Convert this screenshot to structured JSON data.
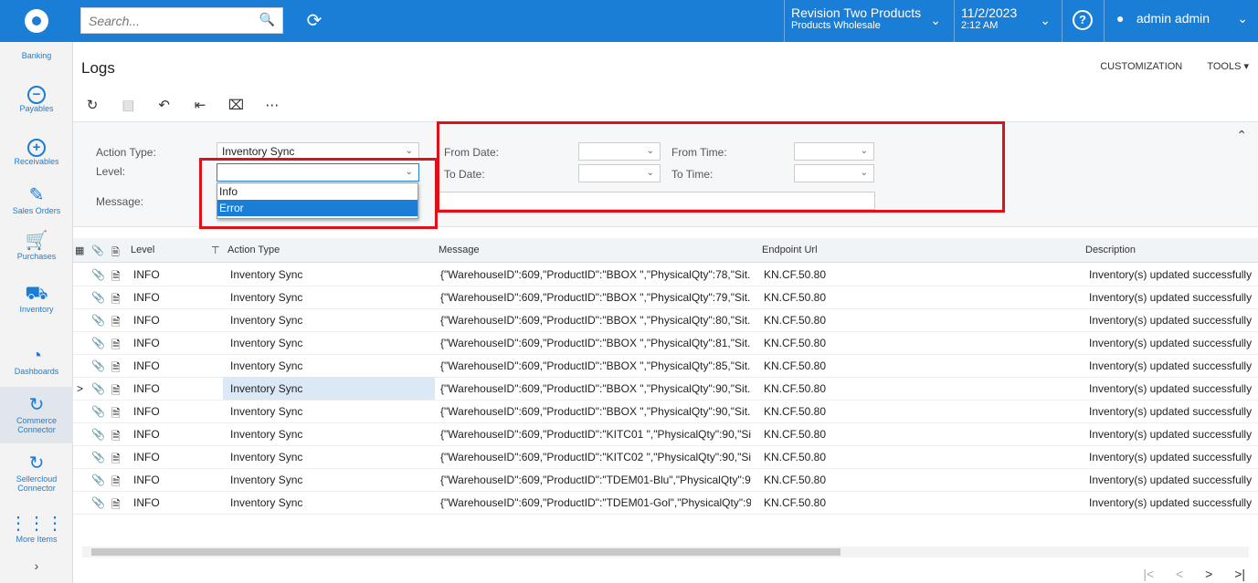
{
  "topbar": {
    "search_placeholder": "Search...",
    "branch_name": "Revision Two Products",
    "branch_sub": "Products Wholesale",
    "date": "11/2/2023",
    "time": "2:12 AM",
    "user": "admin admin"
  },
  "sidebar": {
    "items": [
      {
        "label": "Banking"
      },
      {
        "label": "Payables"
      },
      {
        "label": "Receivables"
      },
      {
        "label": "Sales Orders"
      },
      {
        "label": "Purchases"
      },
      {
        "label": "Inventory"
      },
      {
        "label": "Dashboards"
      },
      {
        "label": "Commerce Connector"
      },
      {
        "label": "Sellercloud Connector"
      },
      {
        "label": "More Items"
      }
    ]
  },
  "page": {
    "title": "Logs",
    "customization": "CUSTOMIZATION",
    "tools": "TOOLS"
  },
  "filter": {
    "action_type_label": "Action Type:",
    "action_type_value": "Inventory Sync",
    "level_label": "Level:",
    "level_value": "",
    "message_label": "Message:",
    "from_date_label": "From Date:",
    "to_date_label": "To Date:",
    "from_time_label": "From Time:",
    "to_time_label": "To Time:",
    "level_options": [
      "Info",
      "Error"
    ]
  },
  "grid": {
    "columns": [
      "Level",
      "Action Type",
      "Message",
      "Endpoint Url",
      "Description"
    ],
    "rows": [
      {
        "level": "INFO",
        "action": "Inventory Sync",
        "message": "{\"WarehouseID\":609,\"ProductID\":\"BBOX \",\"PhysicalQty\":78,\"Sit...",
        "endpoint": "KN.CF.50.80",
        "description": "Inventory(s) updated successfully"
      },
      {
        "level": "INFO",
        "action": "Inventory Sync",
        "message": "{\"WarehouseID\":609,\"ProductID\":\"BBOX \",\"PhysicalQty\":79,\"Sit...",
        "endpoint": "KN.CF.50.80",
        "description": "Inventory(s) updated successfully"
      },
      {
        "level": "INFO",
        "action": "Inventory Sync",
        "message": "{\"WarehouseID\":609,\"ProductID\":\"BBOX \",\"PhysicalQty\":80,\"Sit...",
        "endpoint": "KN.CF.50.80",
        "description": "Inventory(s) updated successfully"
      },
      {
        "level": "INFO",
        "action": "Inventory Sync",
        "message": "{\"WarehouseID\":609,\"ProductID\":\"BBOX \",\"PhysicalQty\":81,\"Sit...",
        "endpoint": "KN.CF.50.80",
        "description": "Inventory(s) updated successfully"
      },
      {
        "level": "INFO",
        "action": "Inventory Sync",
        "message": "{\"WarehouseID\":609,\"ProductID\":\"BBOX \",\"PhysicalQty\":85,\"Sit...",
        "endpoint": "KN.CF.50.80",
        "description": "Inventory(s) updated successfully"
      },
      {
        "level": "INFO",
        "action": "Inventory Sync",
        "message": "{\"WarehouseID\":609,\"ProductID\":\"BBOX \",\"PhysicalQty\":90,\"Sit...",
        "endpoint": "KN.CF.50.80",
        "description": "Inventory(s) updated successfully"
      },
      {
        "level": "INFO",
        "action": "Inventory Sync",
        "message": "{\"WarehouseID\":609,\"ProductID\":\"BBOX \",\"PhysicalQty\":90,\"Sit...",
        "endpoint": "KN.CF.50.80",
        "description": "Inventory(s) updated successfully"
      },
      {
        "level": "INFO",
        "action": "Inventory Sync",
        "message": "{\"WarehouseID\":609,\"ProductID\":\"KITC01 \",\"PhysicalQty\":90,\"Si...",
        "endpoint": "KN.CF.50.80",
        "description": "Inventory(s) updated successfully"
      },
      {
        "level": "INFO",
        "action": "Inventory Sync",
        "message": "{\"WarehouseID\":609,\"ProductID\":\"KITC02 \",\"PhysicalQty\":90,\"Si...",
        "endpoint": "KN.CF.50.80",
        "description": "Inventory(s) updated successfully"
      },
      {
        "level": "INFO",
        "action": "Inventory Sync",
        "message": "{\"WarehouseID\":609,\"ProductID\":\"TDEM01-Blu\",\"PhysicalQty\":9...",
        "endpoint": "KN.CF.50.80",
        "description": "Inventory(s) updated successfully"
      },
      {
        "level": "INFO",
        "action": "Inventory Sync",
        "message": "{\"WarehouseID\":609,\"ProductID\":\"TDEM01-Gol\",\"PhysicalQty\":9...",
        "endpoint": "KN.CF.50.80",
        "description": "Inventory(s) updated successfully"
      }
    ]
  },
  "colors": {
    "brand": "#1a7dd6",
    "highlight": "#e0101b"
  }
}
